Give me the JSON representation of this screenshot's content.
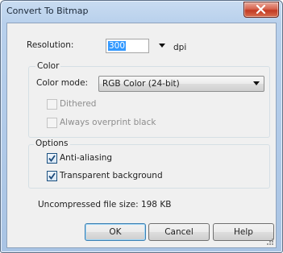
{
  "window": {
    "title": "Convert To Bitmap"
  },
  "resolution": {
    "label": "Resolution:",
    "value": "300",
    "unit": "dpi"
  },
  "color_group": {
    "legend": "Color",
    "mode_label": "Color mode:",
    "mode_value": "RGB Color (24-bit)",
    "dithered_label": "Dithered",
    "overprint_label": "Always overprint black"
  },
  "options_group": {
    "legend": "Options",
    "antialias_label": "Anti-aliasing",
    "transparent_label": "Transparent background"
  },
  "file_size": "Uncompressed file size: 198 KB",
  "buttons": {
    "ok": "OK",
    "cancel": "Cancel",
    "help": "Help"
  },
  "colors": {
    "selection": "#3399ff",
    "title_bar": "#b8d0ec",
    "close_button": "#c23a23"
  }
}
